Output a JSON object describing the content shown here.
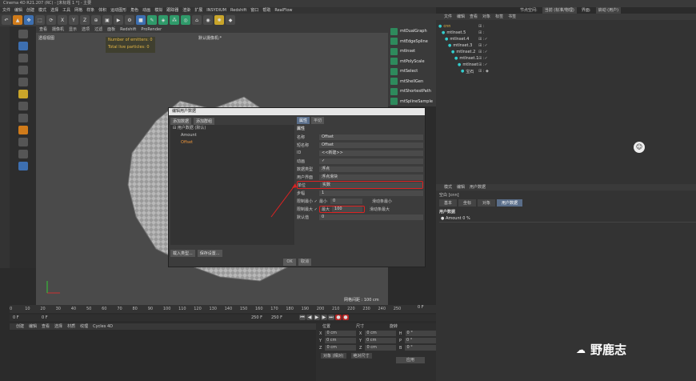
{
  "window": {
    "title": "Cinema 4D R21.207 (RC) - [未标题 1 *] - 主要"
  },
  "menu": [
    "文件",
    "编辑",
    "创建",
    "模式",
    "选择",
    "工具",
    "网格",
    "样条",
    "体积",
    "运动图形",
    "角色",
    "动画",
    "模拟",
    "跟踪器",
    "渲染",
    "扩展",
    "INSYDIUM",
    "Redshift",
    "窗口",
    "帮助",
    "RealFlow"
  ],
  "top_right": {
    "node_space": "节点空间:",
    "node_value": "当前 (标准/物理)",
    "interface": "界面:",
    "interface_value": "启动 (用户)"
  },
  "viewport": {
    "menu": [
      "查看",
      "摄像机",
      "显示",
      "选项",
      "过滤",
      "面板",
      "Redshift",
      "ProRender"
    ],
    "label": "透视视图",
    "camera": "默认摄像机:*",
    "hud_line1": "Number of emitters: 0",
    "hud_line2": "Total live particles: 0",
    "grid": "网格间距 : 100 cm"
  },
  "plugins": [
    "mtDualGraph",
    "mtEdgeSpline",
    "mtInset",
    "mtPolyScale",
    "mtSelect",
    "mtShellGen",
    "mtShortestPath",
    "mtSplineSample"
  ],
  "object_manager": {
    "menu": [
      "文件",
      "编辑",
      "查看",
      "对象",
      "标签",
      "书签"
    ],
    "objects": [
      {
        "name": "cnn",
        "indent": 0,
        "tag": "⊞ :"
      },
      {
        "name": "mtInset.5",
        "indent": 1,
        "tag": "⊞ :"
      },
      {
        "name": "mtInset.4",
        "indent": 2,
        "tag": "⊞ :✓"
      },
      {
        "name": "mtInset.3",
        "indent": 3,
        "tag": "⊞ :✓"
      },
      {
        "name": "mtInset.2",
        "indent": 4,
        "tag": "⊞ :✓"
      },
      {
        "name": "mtInset.1",
        "indent": 5,
        "tag": "⊞ :✓"
      },
      {
        "name": "mtInset",
        "indent": 6,
        "tag": "⊞ :✓"
      },
      {
        "name": "宝石",
        "indent": 7,
        "tag": "⊞ : ◆"
      }
    ]
  },
  "attribute_manager": {
    "menu": [
      "模式",
      "编辑",
      "用户数据"
    ],
    "object": "空白 [cnn]",
    "tabs": [
      "基本",
      "坐标",
      "对象",
      "用户数据"
    ],
    "active_tab": "用户数据",
    "section": "用户数据",
    "amount": "● Amount  0 %"
  },
  "timeline": {
    "ticks": [
      "0",
      "10",
      "20",
      "30",
      "40",
      "50",
      "60",
      "70",
      "80",
      "90",
      "100",
      "110",
      "120",
      "130",
      "140",
      "150",
      "160",
      "170",
      "180",
      "190",
      "200",
      "210",
      "220",
      "230",
      "240",
      "250"
    ],
    "start": "0 F",
    "current": "0 F",
    "end": "250 F",
    "end2": "250 F",
    "frame_right": "0 F"
  },
  "material": {
    "menu": [
      "创建",
      "编辑",
      "查看",
      "选择",
      "材质",
      "纹理",
      "Cycles 4D"
    ]
  },
  "coords": {
    "head": [
      "位置",
      "尺寸",
      "旋转"
    ],
    "rows": [
      {
        "axis": "X",
        "pos": "0 cm",
        "size": "0 cm",
        "rot_axis": "H",
        "rot": "0 °"
      },
      {
        "axis": "Y",
        "pos": "0 cm",
        "size": "0 cm",
        "rot_axis": "P",
        "rot": "0 °"
      },
      {
        "axis": "Z",
        "pos": "0 cm",
        "size": "0 cm",
        "rot_axis": "B",
        "rot": "0 °"
      }
    ],
    "mode": "对象 (相对)",
    "size_mode": "绝对尺寸",
    "apply": "应用"
  },
  "dialog": {
    "title": "编辑用户数据",
    "add_data": "添加数据",
    "add_group": "添加群组",
    "tree": [
      {
        "label": "⊟ 用户数据 (默认)",
        "indent": 0
      },
      {
        "label": "Amount",
        "indent": 1
      },
      {
        "label": "Offset",
        "indent": 1
      }
    ],
    "tabs": [
      "属性",
      "平切"
    ],
    "section": "属性",
    "fields": [
      {
        "label": "名称",
        "value": "Offset"
      },
      {
        "label": "短名称",
        "value": "Offset"
      },
      {
        "label": "ID",
        "value": "<<新建>>"
      },
      {
        "label": "动画",
        "value": "✓"
      },
      {
        "label": "数据类型",
        "value": "浮点"
      },
      {
        "label": "用户界面",
        "value": "浮点滑块"
      },
      {
        "label": "单位",
        "value": "实数"
      },
      {
        "label": "步幅",
        "value": "1"
      }
    ],
    "min_label": "限制最小 ✓",
    "min_name": "最小",
    "min_value": "0",
    "slider_min": "滑动条最小",
    "max_label": "限制最大 ✓",
    "max_name": "最大",
    "max_value": "100",
    "slider_max": "滑动条最大",
    "default_label": "默认值",
    "default_value": "0",
    "load": "载入类型...",
    "save": "保存设置...",
    "ok": "OK",
    "cancel": "取消"
  },
  "watermark": "野鹿志"
}
